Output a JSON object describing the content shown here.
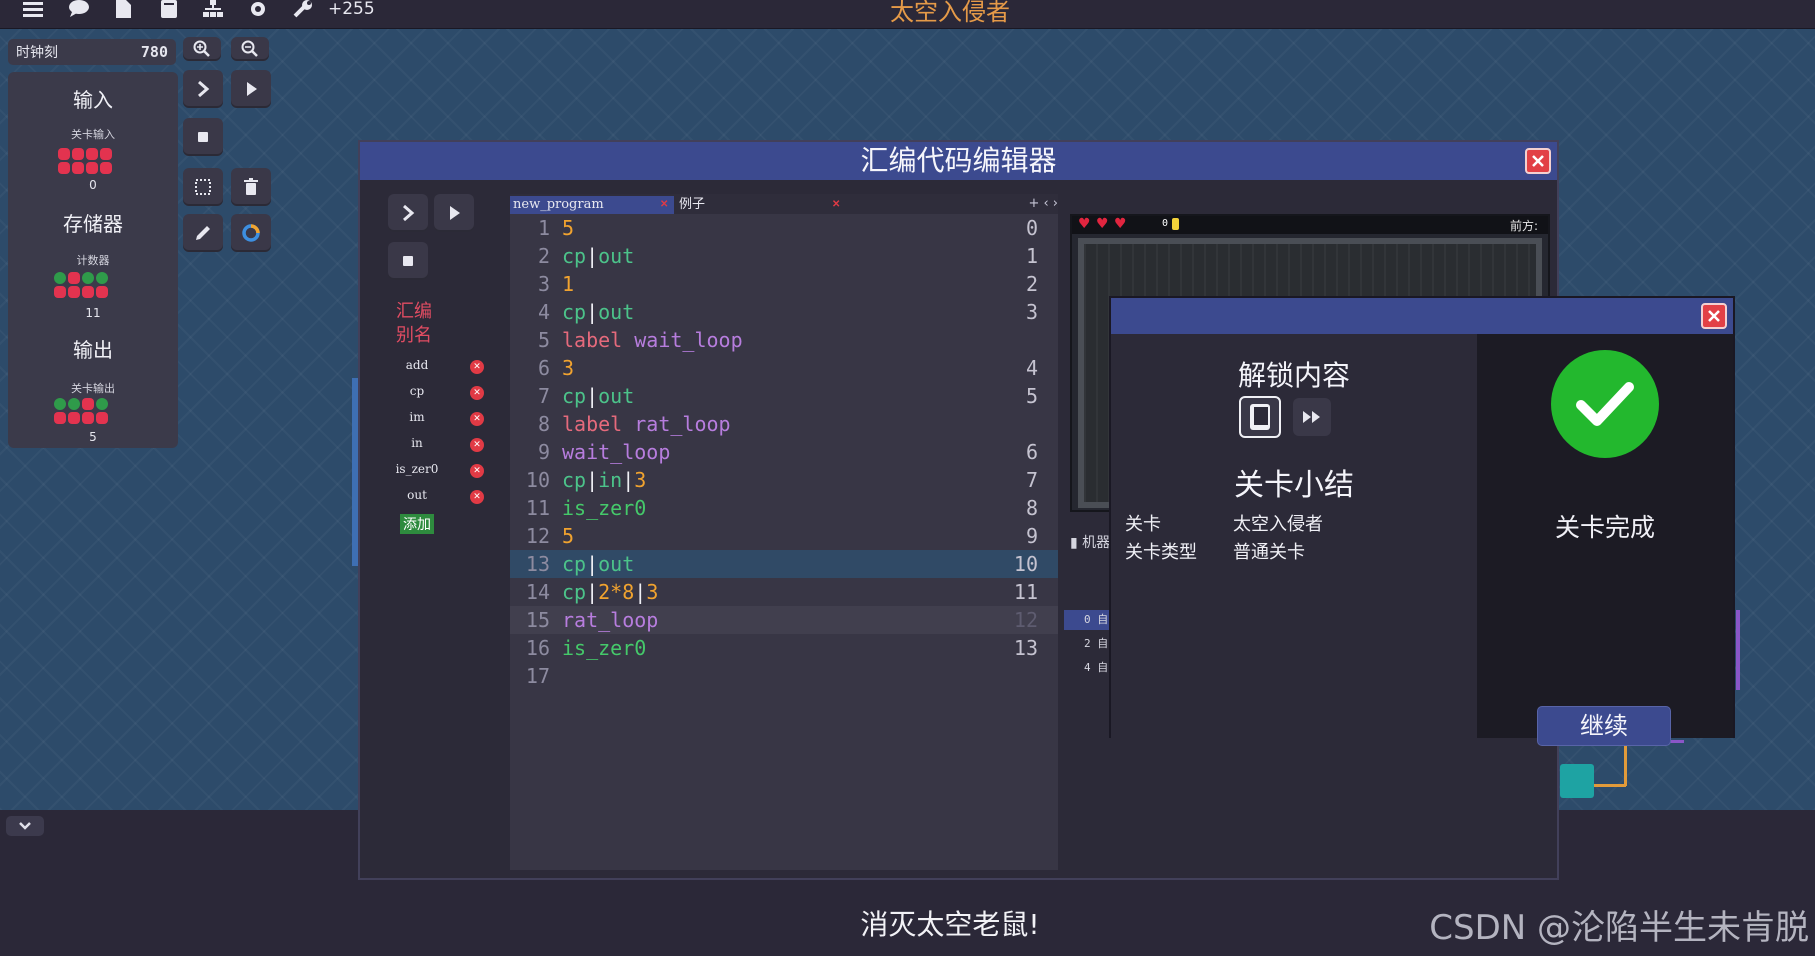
{
  "topbar": {
    "count": "+255",
    "title": "太空入侵者"
  },
  "tick": {
    "label": "时钟刻",
    "value": "780"
  },
  "io": {
    "input_title": "输入",
    "input_sub": "关卡输入",
    "input_value": "0",
    "storage_title": "存储器",
    "storage_sub": "计数器",
    "storage_value": "11",
    "output_title": "输出",
    "output_sub": "关卡输出",
    "output_value": "5"
  },
  "editor": {
    "title": "汇编代码编辑器",
    "alias_title_1": "汇编",
    "alias_title_2": "别名",
    "aliases": [
      "add",
      "cp",
      "im",
      "in",
      "is_zer0",
      "out"
    ],
    "add_label": "添加",
    "tabs": [
      {
        "label": "new_program"
      },
      {
        "label": "例子"
      }
    ],
    "tab_controls": "+ ‹ ›",
    "lines": [
      {
        "n": "1",
        "addr": "0"
      },
      {
        "n": "2",
        "addr": "1"
      },
      {
        "n": "3",
        "addr": "2"
      },
      {
        "n": "4",
        "addr": "3"
      },
      {
        "n": "5",
        "addr": ""
      },
      {
        "n": "6",
        "addr": "4"
      },
      {
        "n": "7",
        "addr": "5"
      },
      {
        "n": "8",
        "addr": ""
      },
      {
        "n": "9",
        "addr": "6"
      },
      {
        "n": "10",
        "addr": "7"
      },
      {
        "n": "11",
        "addr": "8"
      },
      {
        "n": "12",
        "addr": "9"
      },
      {
        "n": "13",
        "addr": "10"
      },
      {
        "n": "14",
        "addr": "11"
      },
      {
        "n": "15",
        "addr": "12"
      },
      {
        "n": "16",
        "addr": "13"
      },
      {
        "n": "17",
        "addr": ""
      }
    ],
    "tokens": {
      "l1": "5",
      "cp": "cp",
      "out": "out",
      "bar": "|",
      "l3": "1",
      "label": "label",
      "wait_loop": "wait_loop",
      "l6": "3",
      "rat_loop": "rat_loop",
      "in": "in",
      "three": "3",
      "is_zer0": "is_zer0",
      "l12": "5",
      "two_eight": "2*8"
    }
  },
  "preview": {
    "gold": "0",
    "ahead": "前方:",
    "machine_label": "机器",
    "list_numbers": [
      "0",
      "2",
      "4"
    ],
    "list_glyph": "自"
  },
  "modal": {
    "unlock_title": "解锁内容",
    "summary_title": "关卡小结",
    "level_key": "关卡",
    "level_value": "太空入侵者",
    "type_key": "关卡类型",
    "type_value": "普通关卡",
    "complete_label": "关卡完成",
    "continue_label": "继续"
  },
  "footer": {
    "tagline": "消灭太空老鼠!",
    "watermark": "CSDN @沦陷半生未肯脱"
  },
  "colors": {
    "accent": "#3c4a8f",
    "close": "#e24046",
    "success": "#23b82e",
    "workspace": "#2d4b6a"
  }
}
